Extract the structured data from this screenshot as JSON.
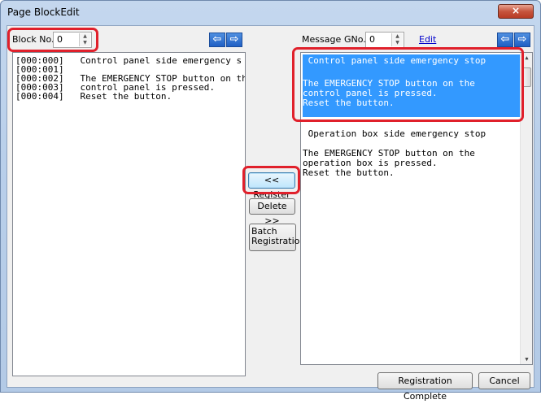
{
  "window": {
    "title": "Page BlockEdit",
    "close_glyph": "×"
  },
  "left": {
    "block_no_label": "Block No.",
    "block_no_value": "0",
    "lines": [
      {
        "addr": "[000:000]",
        "text": "Control panel side emergency s"
      },
      {
        "addr": "[000:001]",
        "text": ""
      },
      {
        "addr": "[000:002]",
        "text": "The EMERGENCY STOP button on th"
      },
      {
        "addr": "[000:003]",
        "text": "control panel is pressed."
      },
      {
        "addr": "[000:004]",
        "text": "Reset the button."
      }
    ]
  },
  "right": {
    "message_label": "Message",
    "gno_label": "GNo.",
    "gno_value": "0",
    "edit_link": "Edit",
    "selected_message": [
      " Control panel side emergency stop",
      "",
      "The EMERGENCY STOP button on the",
      "control panel is pressed.",
      "Reset the button."
    ],
    "second_message": [
      " Operation box side emergency stop",
      "",
      "The EMERGENCY STOP button on the",
      "operation box is pressed.",
      "Reset the button."
    ]
  },
  "middle": {
    "register_label": "<< Register",
    "delete_label": "Delete >>",
    "batch_line1": "Batch",
    "batch_line2": "Registration"
  },
  "footer": {
    "complete_label": "Registration Complete",
    "cancel_label": "Cancel"
  },
  "icons": {
    "nav_left": "arrow-left-icon",
    "nav_right": "arrow-right-icon"
  },
  "colors": {
    "highlight_red": "#e0202b",
    "selection_blue": "#3399ff",
    "nav_blue": "#1f5fc4"
  }
}
